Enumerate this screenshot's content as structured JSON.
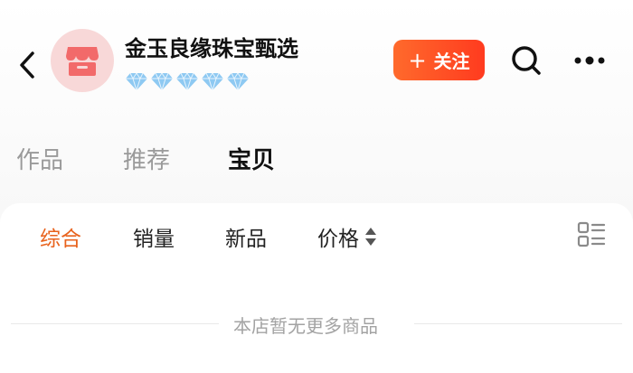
{
  "header": {
    "shop_name": "金玉良缘珠宝甄选",
    "diamond_count": 5,
    "follow_label": "关注",
    "follow_plus": "+",
    "icons": {
      "back": "chevron-left-icon",
      "avatar": "store-icon",
      "search": "search-icon",
      "more": "more-dots-icon",
      "diamond": "diamond-icon"
    }
  },
  "tabs": [
    {
      "label": "作品",
      "active": false
    },
    {
      "label": "推荐",
      "active": false
    },
    {
      "label": "宝贝",
      "active": true
    }
  ],
  "sort_bar": {
    "items": [
      {
        "label": "综合",
        "active": true
      },
      {
        "label": "销量",
        "active": false
      },
      {
        "label": "新品",
        "active": false
      },
      {
        "label": "价格",
        "active": false,
        "has_sort_arrows": true
      }
    ],
    "layout_toggle_icon": "list-layout-icon"
  },
  "empty_state": {
    "text": "本店暂无更多商品"
  },
  "colors": {
    "accent_orange": "#e8621c",
    "follow_gradient_start": "#ff6a2c",
    "follow_gradient_end": "#ff3b1f",
    "avatar_bg": "#f8d8d8",
    "avatar_icon": "#f26a6a",
    "diamond": "#8ec9f2",
    "muted_text": "#9a9a9a"
  }
}
